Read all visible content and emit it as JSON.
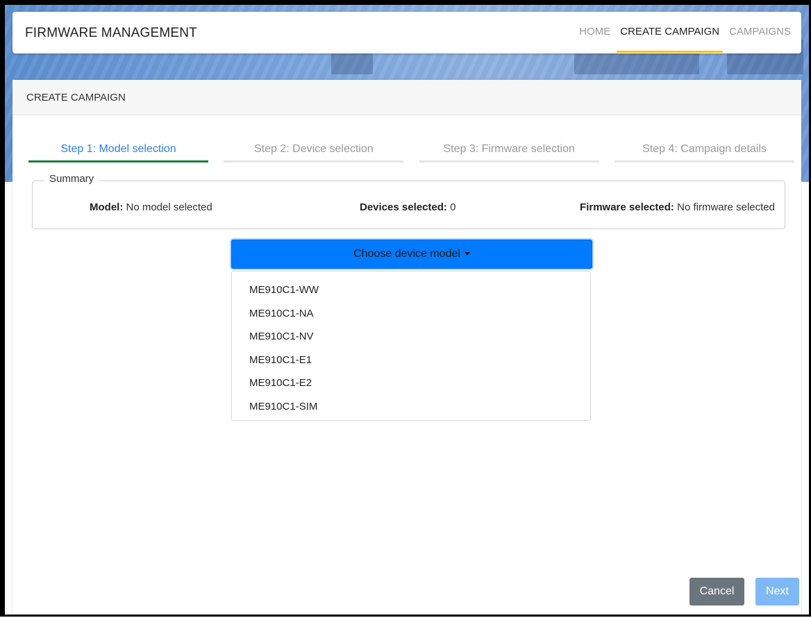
{
  "navbar": {
    "brand": "FIRMWARE MANAGEMENT",
    "links": [
      "HOME",
      "CREATE CAMPAIGN",
      "CAMPAIGNS"
    ],
    "active_link": "CREATE CAMPAIGN"
  },
  "card": {
    "title": "CREATE CAMPAIGN"
  },
  "steps": [
    "Step 1: Model selection",
    "Step 2: Device selection",
    "Step 3: Firmware selection",
    "Step 4: Campaign details"
  ],
  "active_step": 1,
  "summary": {
    "legend": "Summary",
    "model_label": "Model:",
    "model_value": "No model selected",
    "devices_label": "Devices selected:",
    "devices_value": "0",
    "firmware_label": "Firmware selected:",
    "firmware_value": "No firmware selected"
  },
  "dropdown": {
    "label": "Choose device model",
    "options": [
      "ME910C1-WW",
      "ME910C1-NA",
      "ME910C1-NV",
      "ME910C1-E1",
      "ME910C1-E2",
      "ME910C1-SIM"
    ]
  },
  "buttons": {
    "cancel": "Cancel",
    "next": "Next"
  },
  "colors": {
    "primary": "#007bff",
    "active_step_text": "#2f80ed",
    "active_step_underline": "#188038",
    "nav_active_underline": "#f5c518",
    "cancel_bg": "#6c757d",
    "next_bg_disabled": "#7fb9f5"
  }
}
